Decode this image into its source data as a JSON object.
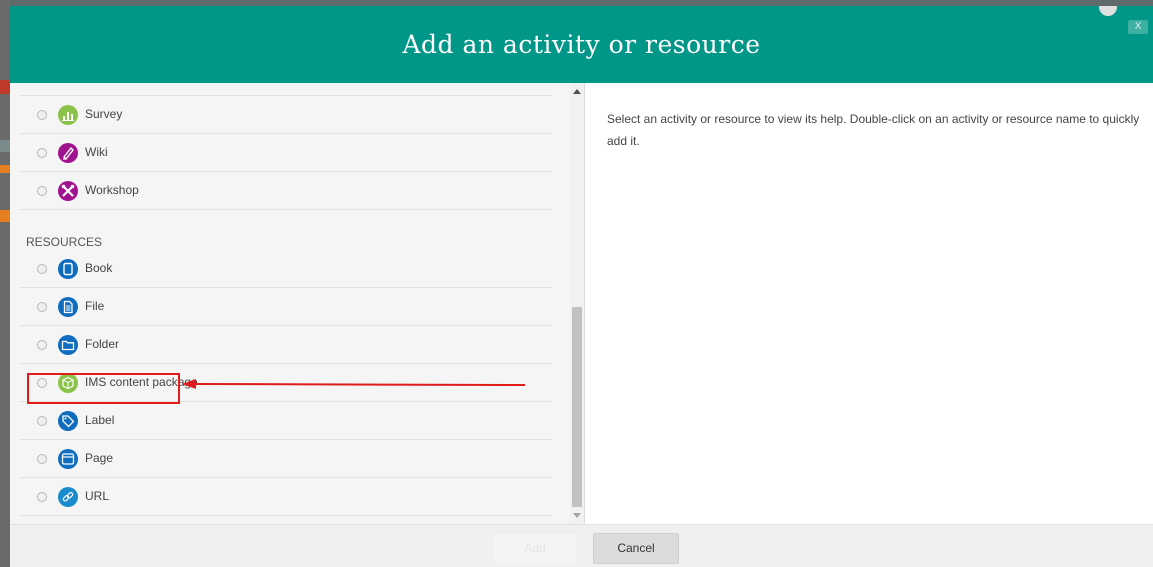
{
  "dialog": {
    "title": "Add an activity or resource",
    "close_label": "X"
  },
  "activities": [
    {
      "label": "Survey",
      "icon": "survey-chart-icon",
      "color": "#8bc34a"
    },
    {
      "label": "Wiki",
      "icon": "wiki-pen-icon",
      "color": "#a1138e"
    },
    {
      "label": "Workshop",
      "icon": "workshop-tools-icon",
      "color": "#a1138e"
    }
  ],
  "resources_heading": "RESOURCES",
  "resources": [
    {
      "label": "Book",
      "icon": "book-icon",
      "color": "#0f6cbf"
    },
    {
      "label": "File",
      "icon": "file-icon",
      "color": "#0f6cbf"
    },
    {
      "label": "Folder",
      "icon": "folder-icon",
      "color": "#0f6cbf"
    },
    {
      "label": "IMS content package",
      "icon": "ims-package-icon",
      "color": "#8bc34a"
    },
    {
      "label": "Label",
      "icon": "label-tag-icon",
      "color": "#0f6cbf"
    },
    {
      "label": "Page",
      "icon": "page-icon",
      "color": "#0f6cbf"
    },
    {
      "label": "URL",
      "icon": "url-link-icon",
      "color": "#1a8ccd"
    }
  ],
  "help_text": "Select an activity or resource to view its help. Double-click on an activity or resource name to quickly add it.",
  "footer": {
    "add_label": "Add",
    "cancel_label": "Cancel"
  },
  "colors": {
    "header": "#009688",
    "annotation": "#e01b1b"
  }
}
